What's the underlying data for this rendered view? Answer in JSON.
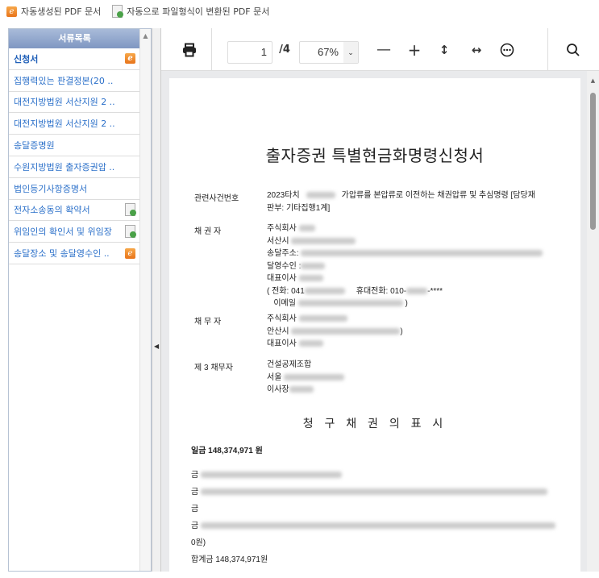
{
  "legend": {
    "auto_label": "자동생성된 PDF 문서",
    "converted_label": "자동으로 파일형식이 변환된 PDF 문서"
  },
  "sidebar": {
    "title": "서류목록",
    "items": [
      {
        "label": "신청서",
        "icon": "e-doc-icon"
      },
      {
        "label": "집행력있는 판결정본(20 ..",
        "icon": ""
      },
      {
        "label": "대전지방법원 서산지원 2 ..",
        "icon": ""
      },
      {
        "label": "대전지방법원 서산지원 2 ..",
        "icon": ""
      },
      {
        "label": "송달증명원",
        "icon": ""
      },
      {
        "label": "수원지방법원 출자증권압 ..",
        "icon": ""
      },
      {
        "label": "법인등기사항증명서",
        "icon": ""
      },
      {
        "label": "전자소송동의 확약서",
        "icon": "converted-file-icon"
      },
      {
        "label": "위임인의 확인서 및 위임장",
        "icon": "converted-file-icon"
      },
      {
        "label": "송달장소 및 송달영수인 ..",
        "icon": "e-doc-icon"
      }
    ]
  },
  "toolbar": {
    "page": "1",
    "total_pages": "/4",
    "zoom": "67%"
  },
  "document": {
    "title": "출자증권 특별현금화명령신청서",
    "case_label": "관련사건번호",
    "case_a": "2023타치",
    "case_b": "가압류를 본압류로 이전하는 채권압류 및 추심명령  [담당재",
    "case_c": "판부: 기타집행1계]",
    "creditor_label": "채 권 자",
    "c1": "주식회사",
    "c2": "서산시",
    "c3": "송달주소:",
    "c4": "달영수인 :",
    "c5": "대표이사",
    "c6a": "(  전화: 041",
    "c6b": "휴대전화: 010-",
    "c6c": "-****",
    "c7": "이메일",
    "c7b": ")",
    "debtor_label": "채 무 자",
    "d1": "주식회사",
    "d2": "안산시",
    "d2b": ")",
    "d3": "대표이사",
    "third_label": "제 3 채무자",
    "t1": "건설공제조합",
    "t2": "서울",
    "t3": "이사장",
    "claim_title": "청 구 채 권 의  표 시",
    "total_bold": "일금 148,374,971 원",
    "geum": "금",
    "zero": "0원)",
    "sum": "합계금 148,374,971원"
  }
}
